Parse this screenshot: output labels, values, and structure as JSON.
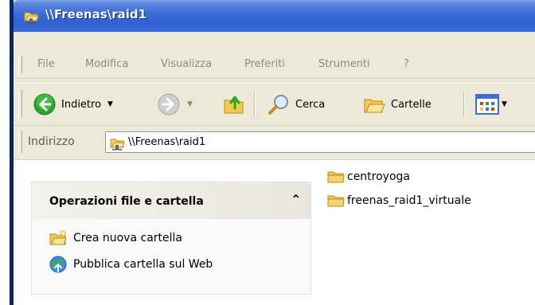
{
  "window": {
    "title": "\\\\Freenas\\raid1"
  },
  "menu": {
    "items": [
      "File",
      "Modifica",
      "Visualizza",
      "Preferiti",
      "Strumenti",
      "?"
    ]
  },
  "toolbar": {
    "back_label": "Indietro",
    "search_label": "Cerca",
    "folders_label": "Cartelle"
  },
  "address": {
    "label": "Indirizzo",
    "value": "\\\\Freenas\\raid1"
  },
  "tasks": {
    "title": "Operazioni file e cartella",
    "collapse_glyph": "»",
    "items": [
      {
        "label": "Crea nuova cartella"
      },
      {
        "label": "Pubblica cartella sul Web"
      }
    ]
  },
  "files": [
    {
      "name": "centroyoga"
    },
    {
      "name": "freenas_raid1_virtuale"
    }
  ],
  "colors": {
    "titlebar": "#2f63d3",
    "chrome": "#ece9d8",
    "back_green": "#2ca52c",
    "folder_yellow": "#f2c94c"
  }
}
